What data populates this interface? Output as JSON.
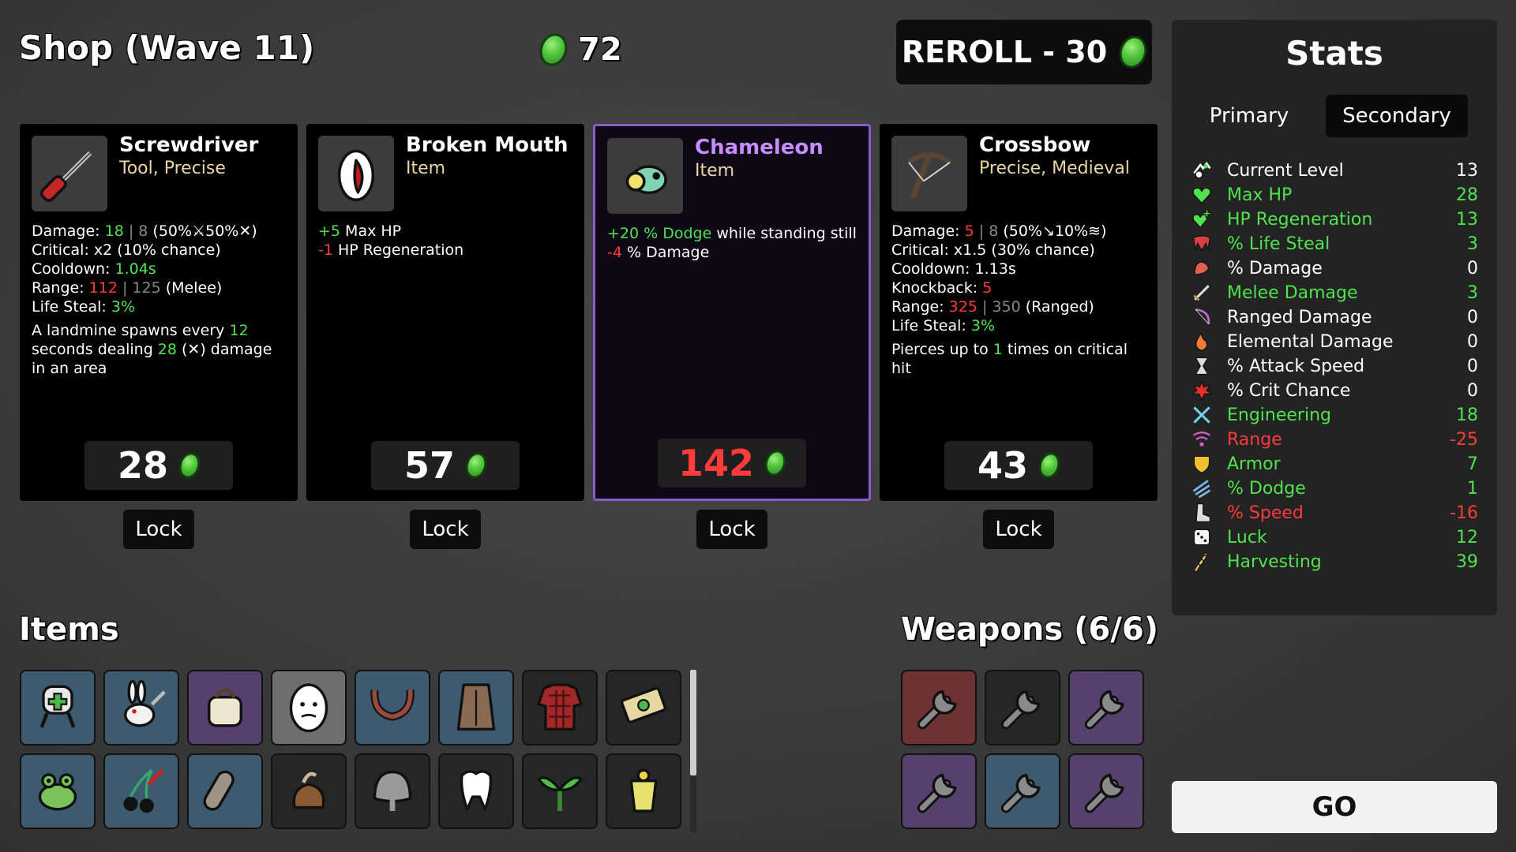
{
  "shop": {
    "title": "Shop (Wave 11)",
    "gold": "72",
    "reroll_label": "REROLL - 30"
  },
  "cards": [
    {
      "name": "Screwdriver",
      "type": "Tool, Precise",
      "price": "28",
      "lock_label": "Lock",
      "icon": "screwdriver-icon",
      "lines": [
        [
          {
            "t": "Damage: ",
            "c": "w"
          },
          {
            "t": "18",
            "c": "g"
          },
          {
            "t": " | ",
            "c": "gy"
          },
          {
            "t": "8",
            "c": "gy"
          },
          {
            "t": " (50%",
            "c": "w"
          },
          {
            "t": "⚔",
            "c": "w"
          },
          {
            "t": "50%",
            "c": "w"
          },
          {
            "t": "✕",
            "c": "w"
          },
          {
            "t": ")",
            "c": "w"
          }
        ],
        [
          {
            "t": "Critical: ",
            "c": "w"
          },
          {
            "t": "x2 (10% chance)",
            "c": "w"
          }
        ],
        [
          {
            "t": "Cooldown: ",
            "c": "w"
          },
          {
            "t": "1.04s",
            "c": "g"
          }
        ],
        [
          {
            "t": "Range: ",
            "c": "w"
          },
          {
            "t": "112",
            "c": "r"
          },
          {
            "t": " | 125",
            "c": "gy"
          },
          {
            "t": " (Melee)",
            "c": "w"
          }
        ],
        [
          {
            "t": "Life Steal: ",
            "c": "w"
          },
          {
            "t": "3%",
            "c": "g"
          }
        ]
      ],
      "desc": [
        {
          "t": "A landmine spawns every ",
          "c": "w"
        },
        {
          "t": "12",
          "c": "g"
        },
        {
          "t": " seconds dealing ",
          "c": "w"
        },
        {
          "t": "28",
          "c": "g"
        },
        {
          "t": " (✕) damage in an area",
          "c": "w"
        }
      ]
    },
    {
      "name": "Broken Mouth",
      "type": "Item",
      "price": "57",
      "lock_label": "Lock",
      "icon": "broken-mouth-icon",
      "lines": [
        [
          {
            "t": "+5",
            "c": "g"
          },
          {
            "t": " Max HP",
            "c": "w"
          }
        ],
        [
          {
            "t": "-1",
            "c": "r"
          },
          {
            "t": " HP Regeneration",
            "c": "w"
          }
        ]
      ],
      "desc": []
    },
    {
      "name": "Chameleon",
      "type": "Item",
      "price": "142",
      "lock_label": "Lock",
      "icon": "chameleon-icon",
      "lines": [
        [
          {
            "t": "+20 % Dodge",
            "c": "g"
          },
          {
            "t": " while standing still",
            "c": "w"
          }
        ],
        [
          {
            "t": "-4",
            "c": "r"
          },
          {
            "t": " % Damage",
            "c": "w"
          }
        ]
      ],
      "desc": []
    },
    {
      "name": "Crossbow",
      "type": "Precise, Medieval",
      "price": "43",
      "lock_label": "Lock",
      "icon": "crossbow-icon",
      "lines": [
        [
          {
            "t": "Damage: ",
            "c": "w"
          },
          {
            "t": "5",
            "c": "r"
          },
          {
            "t": " | 8",
            "c": "gy"
          },
          {
            "t": " (50%",
            "c": "w"
          },
          {
            "t": "↘",
            "c": "w"
          },
          {
            "t": "10%",
            "c": "w"
          },
          {
            "t": "≋",
            "c": "w"
          },
          {
            "t": ")",
            "c": "w"
          }
        ],
        [
          {
            "t": "Critical: ",
            "c": "w"
          },
          {
            "t": "x1.5 (30% chance)",
            "c": "w"
          }
        ],
        [
          {
            "t": "Cooldown: ",
            "c": "w"
          },
          {
            "t": "1.13s",
            "c": "w"
          }
        ],
        [
          {
            "t": "Knockback: ",
            "c": "w"
          },
          {
            "t": "5",
            "c": "r"
          }
        ],
        [
          {
            "t": "Range: ",
            "c": "w"
          },
          {
            "t": "325",
            "c": "r"
          },
          {
            "t": " | 350",
            "c": "gy"
          },
          {
            "t": " (Ranged)",
            "c": "w"
          }
        ],
        [
          {
            "t": "Life Steal: ",
            "c": "w"
          },
          {
            "t": "3%",
            "c": "g"
          }
        ]
      ],
      "desc": [
        {
          "t": "Pierces up to ",
          "c": "w"
        },
        {
          "t": "1",
          "c": "g"
        },
        {
          "t": " times on critical hit",
          "c": "w"
        }
      ]
    }
  ],
  "items": {
    "title": "Items",
    "slots": [
      {
        "icon": "medkit-robot-icon",
        "bg": "blue"
      },
      {
        "icon": "rabbit-icon",
        "bg": "blue"
      },
      {
        "icon": "bandage-bag-icon",
        "bg": "purple"
      },
      {
        "icon": "egg-face-icon",
        "bg": "grey"
      },
      {
        "icon": "antlers-icon",
        "bg": "blue"
      },
      {
        "icon": "leather-vest-icon",
        "bg": "blue"
      },
      {
        "icon": "plaid-shirt-icon",
        "bg": "dark"
      },
      {
        "icon": "cash-icon",
        "bg": "dark"
      },
      {
        "icon": "frog-icon",
        "bg": "blue"
      },
      {
        "icon": "cherries-icon",
        "bg": "blue"
      },
      {
        "icon": "cast-icon",
        "bg": "blue"
      },
      {
        "icon": "poop-bag-icon",
        "bg": "dark"
      },
      {
        "icon": "helmet-icon",
        "bg": "dark"
      },
      {
        "icon": "tooth-icon",
        "bg": "dark"
      },
      {
        "icon": "sprout-icon",
        "bg": "dark"
      },
      {
        "icon": "yogurt-icon",
        "bg": "dark"
      }
    ]
  },
  "weapons": {
    "title": "Weapons (6/6)",
    "slots": [
      {
        "icon": "wrench-icon",
        "bg": "red"
      },
      {
        "icon": "wrench-icon",
        "bg": "dark"
      },
      {
        "icon": "wrench-icon",
        "bg": "purple"
      },
      {
        "icon": "wrench-icon",
        "bg": "purple"
      },
      {
        "icon": "wrench-icon",
        "bg": "blue"
      },
      {
        "icon": "wrench-icon",
        "bg": "purple"
      }
    ]
  },
  "stats": {
    "title": "Stats",
    "tab_primary": "Primary",
    "tab_secondary": "Secondary",
    "rows": [
      {
        "label": "Current Level",
        "value": "13",
        "color": "w",
        "icon": "level-icon"
      },
      {
        "label": "Max HP",
        "value": "28",
        "color": "g",
        "icon": "heart-icon"
      },
      {
        "label": "HP Regeneration",
        "value": "13",
        "color": "g",
        "icon": "regen-heart-icon"
      },
      {
        "label": "% Life Steal",
        "value": "3",
        "color": "g",
        "icon": "fang-icon"
      },
      {
        "label": "% Damage",
        "value": "0",
        "color": "w",
        "icon": "muscle-icon"
      },
      {
        "label": "Melee Damage",
        "value": "3",
        "color": "g",
        "icon": "sword-icon"
      },
      {
        "label": "Ranged Damage",
        "value": "0",
        "color": "w",
        "icon": "bow-icon"
      },
      {
        "label": "Elemental Damage",
        "value": "0",
        "color": "w",
        "icon": "flame-icon"
      },
      {
        "label": "% Attack Speed",
        "value": "0",
        "color": "w",
        "icon": "hourglass-icon"
      },
      {
        "label": "% Crit Chance",
        "value": "0",
        "color": "w",
        "icon": "crit-icon"
      },
      {
        "label": "Engineering",
        "value": "18",
        "color": "g",
        "icon": "wrench-cross-icon"
      },
      {
        "label": "Range",
        "value": "-25",
        "color": "r",
        "icon": "range-icon"
      },
      {
        "label": "Armor",
        "value": "7",
        "color": "g",
        "icon": "shield-icon"
      },
      {
        "label": "% Dodge",
        "value": "1",
        "color": "g",
        "icon": "dodge-icon"
      },
      {
        "label": "% Speed",
        "value": "-16",
        "color": "r",
        "icon": "boot-icon"
      },
      {
        "label": "Luck",
        "value": "12",
        "color": "g",
        "icon": "dice-icon"
      },
      {
        "label": "Harvesting",
        "value": "39",
        "color": "g",
        "icon": "wheat-icon"
      }
    ]
  },
  "go_label": "GO",
  "colors": {
    "green": "#4fe34f",
    "red": "#ff3b3b",
    "highlight": "#8b5cc8",
    "accent_purple": "#c98cff"
  }
}
